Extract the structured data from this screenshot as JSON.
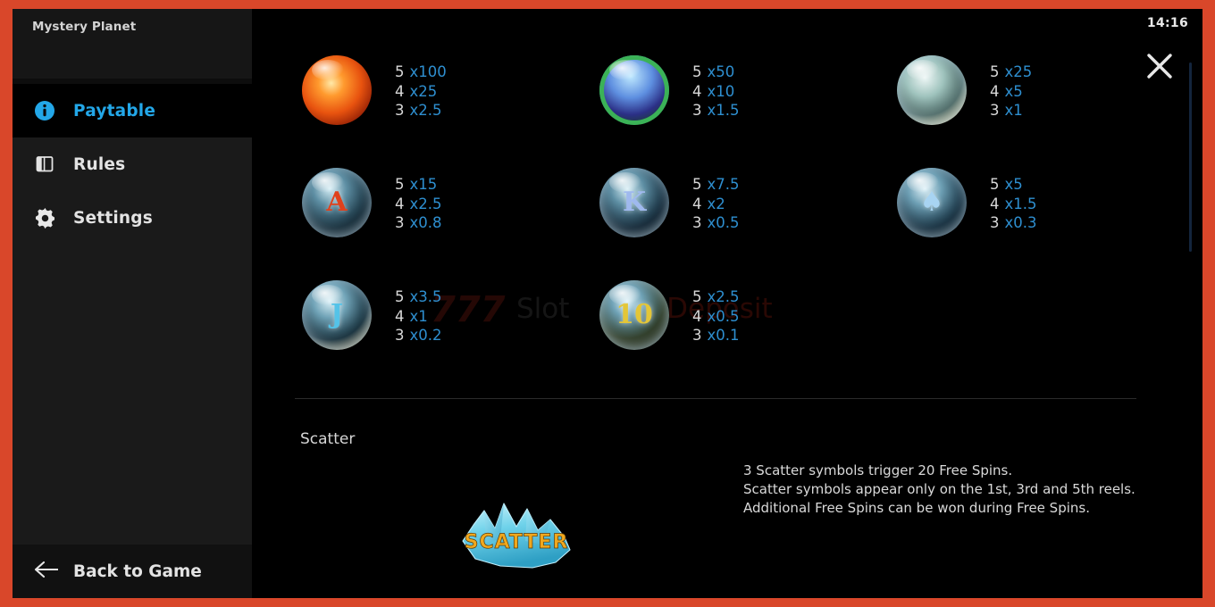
{
  "window": {
    "game_title": "Mystery Planet",
    "clock": "14:16",
    "frame_color": "#d9472a",
    "accent_color": "#23a7e8",
    "multiplier_color": "#2e8fd0"
  },
  "sidebar": {
    "items": [
      {
        "id": "paytable",
        "label": "Paytable",
        "icon": "info-icon",
        "active": true
      },
      {
        "id": "rules",
        "label": "Rules",
        "icon": "book-icon",
        "active": false
      },
      {
        "id": "settings",
        "label": "Settings",
        "icon": "gear-icon",
        "active": false
      }
    ],
    "back": {
      "label": "Back to Game",
      "icon": "arrow-left-icon"
    }
  },
  "main": {
    "close_label": "close-icon",
    "paytable": [
      {
        "symbol": "fire-vortex-orb",
        "glyph": "",
        "payouts": [
          {
            "count": "5",
            "multiplier": "x100"
          },
          {
            "count": "4",
            "multiplier": "x25"
          },
          {
            "count": "3",
            "multiplier": "x2.5"
          }
        ]
      },
      {
        "symbol": "lightning-orb",
        "glyph": "",
        "payouts": [
          {
            "count": "5",
            "multiplier": "x50"
          },
          {
            "count": "4",
            "multiplier": "x10"
          },
          {
            "count": "3",
            "multiplier": "x1.5"
          }
        ]
      },
      {
        "symbol": "tornado-orb",
        "glyph": "",
        "payouts": [
          {
            "count": "5",
            "multiplier": "x25"
          },
          {
            "count": "4",
            "multiplier": "x5"
          },
          {
            "count": "3",
            "multiplier": "x1"
          }
        ]
      },
      {
        "symbol": "card-a-orb",
        "glyph": "A",
        "payouts": [
          {
            "count": "5",
            "multiplier": "x15"
          },
          {
            "count": "4",
            "multiplier": "x2.5"
          },
          {
            "count": "3",
            "multiplier": "x0.8"
          }
        ]
      },
      {
        "symbol": "card-k-orb",
        "glyph": "K",
        "payouts": [
          {
            "count": "5",
            "multiplier": "x7.5"
          },
          {
            "count": "4",
            "multiplier": "x2"
          },
          {
            "count": "3",
            "multiplier": "x0.5"
          }
        ]
      },
      {
        "symbol": "card-spade-orb",
        "glyph": "♠",
        "payouts": [
          {
            "count": "5",
            "multiplier": "x5"
          },
          {
            "count": "4",
            "multiplier": "x1.5"
          },
          {
            "count": "3",
            "multiplier": "x0.3"
          }
        ]
      },
      {
        "symbol": "card-j-orb",
        "glyph": "J",
        "payouts": [
          {
            "count": "5",
            "multiplier": "x3.5"
          },
          {
            "count": "4",
            "multiplier": "x1"
          },
          {
            "count": "3",
            "multiplier": "x0.2"
          }
        ]
      },
      {
        "symbol": "card-10-orb",
        "glyph": "10",
        "payouts": [
          {
            "count": "5",
            "multiplier": "x2.5"
          },
          {
            "count": "4",
            "multiplier": "x0.5"
          },
          {
            "count": "3",
            "multiplier": "x0.1"
          }
        ]
      }
    ],
    "scatter": {
      "title": "Scatter",
      "symbol_label": "SCATTER",
      "lines": [
        "3 Scatter symbols trigger 20 Free Spins.",
        "Scatter symbols appear only on the 1st, 3rd and 5th reels.",
        "Additional Free Spins can be won during Free Spins."
      ]
    }
  },
  "watermark": {
    "part1": "777",
    "part2": "Slot",
    "part3": "NoDeposit"
  }
}
